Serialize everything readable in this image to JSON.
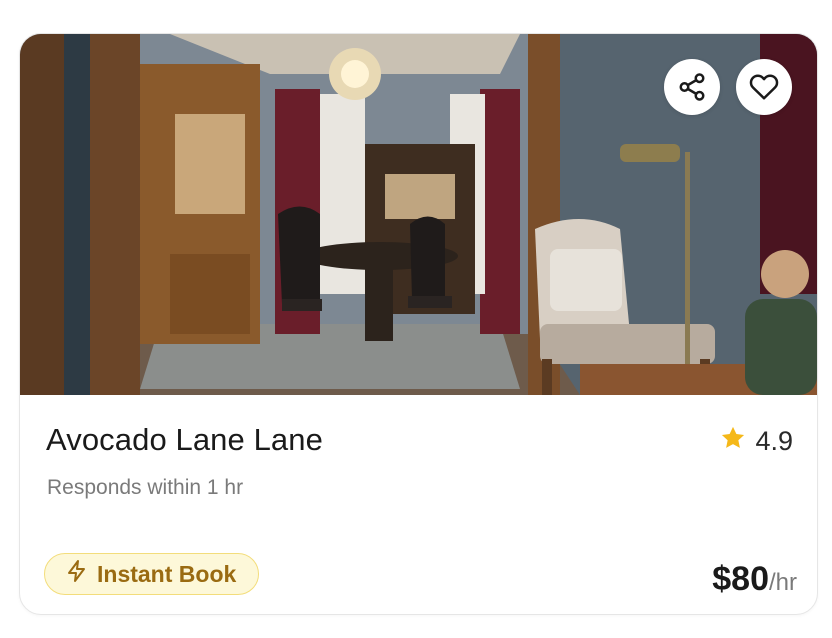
{
  "listing": {
    "title": "Avocado Lane Lane",
    "subtitle": "Responds within 1 hr",
    "rating": "4.9",
    "badge_label": "Instant Book",
    "price": "$80",
    "price_unit": "/hr",
    "photo_alt": "Listing photo"
  },
  "icons": {
    "share": "share-icon",
    "favorite": "heart-icon",
    "rating": "star-icon",
    "badge": "lightning-icon"
  },
  "colors": {
    "star": "#f5b819",
    "badge_bg": "#fdf8d9",
    "badge_border": "#f3dd7b",
    "badge_text": "#9a6b12"
  }
}
